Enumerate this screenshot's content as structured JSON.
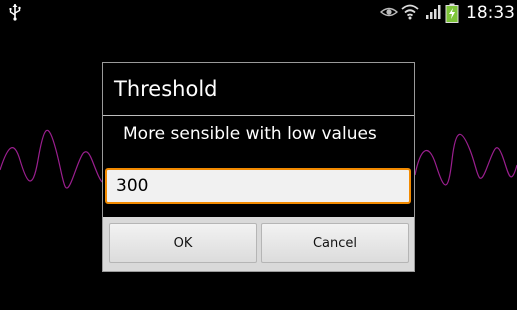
{
  "status_bar": {
    "time": "18:33",
    "icons": [
      "usb-icon",
      "eye-icon",
      "wifi-icon",
      "signal-icon",
      "battery-charging-icon"
    ]
  },
  "background": {
    "waveform_color": "#9b1f8f"
  },
  "dialog": {
    "title": "Threshold",
    "message": "More sensible with low values",
    "input_value": "300",
    "ok_label": "OK",
    "cancel_label": "Cancel"
  },
  "colors": {
    "focus_border": "#f28a00",
    "battery": "#7ec53a"
  }
}
